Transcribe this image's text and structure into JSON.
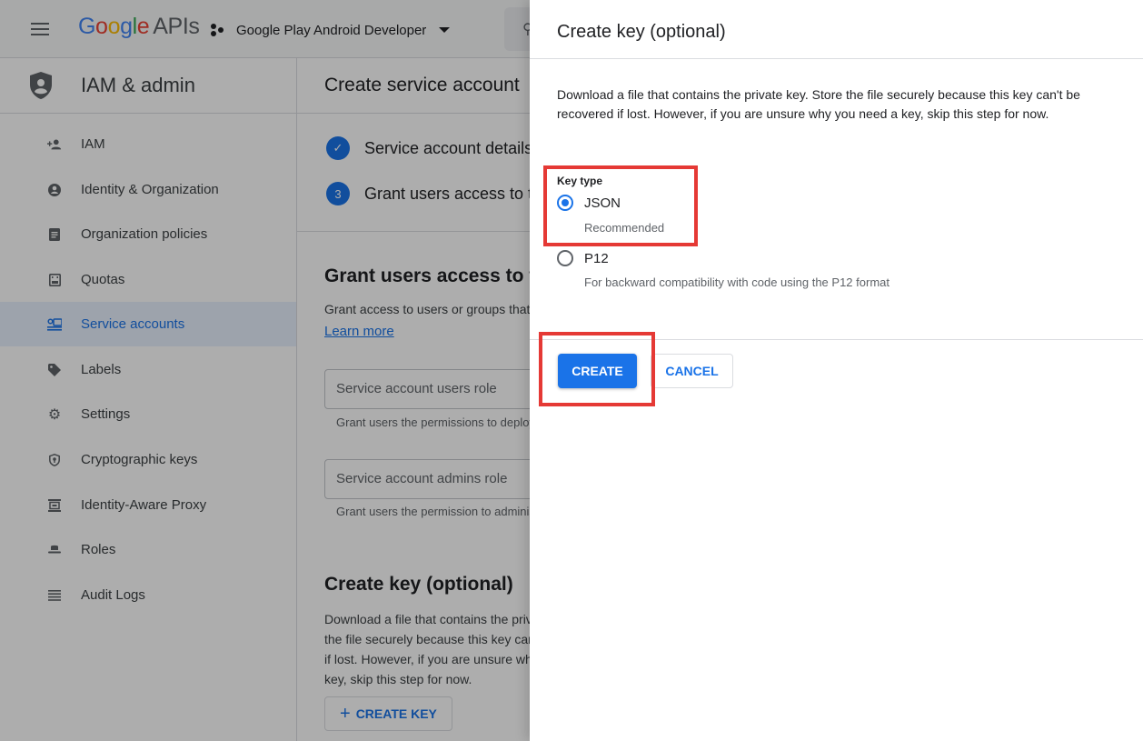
{
  "appbar": {
    "logo_google": "Google",
    "logo_apis": "APIs",
    "project": "Google Play Android Developer"
  },
  "sidebar": {
    "title": "IAM & admin",
    "items": [
      {
        "label": "IAM",
        "icon": "person-add-icon"
      },
      {
        "label": "Identity & Organization",
        "icon": "account-circle-icon"
      },
      {
        "label": "Organization policies",
        "icon": "policy-document-icon"
      },
      {
        "label": "Quotas",
        "icon": "quota-icon"
      },
      {
        "label": "Service accounts",
        "icon": "service-account-icon",
        "active": true
      },
      {
        "label": "Labels",
        "icon": "label-tag-icon"
      },
      {
        "label": "Settings",
        "icon": "gear-icon"
      },
      {
        "label": "Cryptographic keys",
        "icon": "key-shield-icon"
      },
      {
        "label": "Identity-Aware Proxy",
        "icon": "proxy-icon"
      },
      {
        "label": "Roles",
        "icon": "roles-hat-icon"
      },
      {
        "label": "Audit Logs",
        "icon": "list-lines-icon"
      }
    ]
  },
  "main": {
    "title": "Create service account",
    "steps": [
      {
        "badge": "✓",
        "label": "Service account details",
        "done": true
      },
      {
        "badge": "3",
        "label": "Grant users access to this service account"
      }
    ],
    "grant_section": {
      "title": "Grant users access to this service account",
      "desc": "Grant access to users or groups that need to perform actions as this service account.",
      "learn_more": "Learn more",
      "users_role_placeholder": "Service account users role",
      "users_role_hint": "Grant users the permissions to deploy jobs and VMs with this service account",
      "admins_role_placeholder": "Service account admins role",
      "admins_role_hint": "Grant users the permission to administer this service account"
    },
    "key_section": {
      "title": "Create key (optional)",
      "desc": "Download a file that contains the private key. Store the file securely because this key can't be recovered if lost. However, if you are unsure why you need a key, skip this step for now.",
      "button": "CREATE KEY"
    }
  },
  "panel": {
    "title": "Create key (optional)",
    "desc": "Download a file that contains the private key. Store the file securely because this key can't be recovered if lost. However, if you are unsure why you need a key, skip this step for now.",
    "key_type_label": "Key type",
    "options": [
      {
        "label": "JSON",
        "sub": "Recommended",
        "selected": true
      },
      {
        "label": "P12",
        "sub": "For backward compatibility with code using the P12 format",
        "selected": false
      }
    ],
    "create": "CREATE",
    "cancel": "CANCEL"
  },
  "colors": {
    "accent": "#1a73e8",
    "highlight": "#e53935",
    "google_blue": "#4285f4",
    "google_red": "#ea4335",
    "google_yellow": "#fbbc05",
    "google_green": "#34a853"
  }
}
